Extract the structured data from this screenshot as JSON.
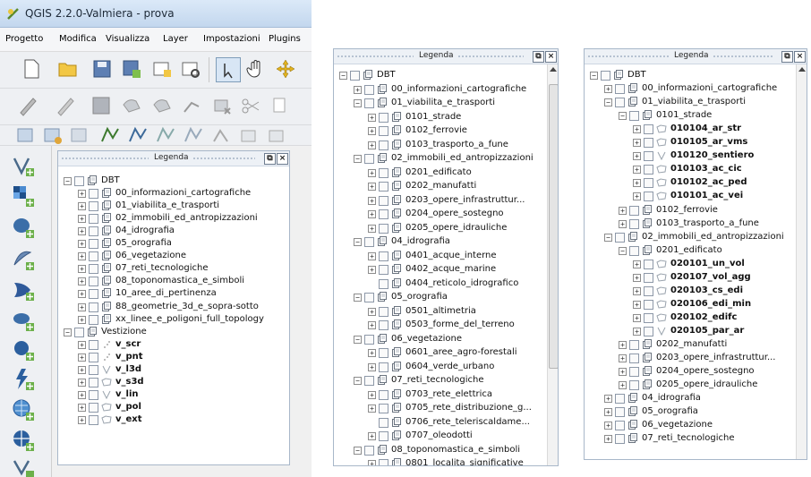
{
  "window": {
    "title": "QGIS 2.2.0-Valmiera - prova"
  },
  "menu": [
    "Progetto",
    "Modifica",
    "Visualizza",
    "Layer",
    "Impostazioni",
    "Plugins"
  ],
  "toolbar_row1": [
    "new-file-icon",
    "open-folder-icon",
    "save-icon",
    "save-as-icon",
    "new-print-composer-icon",
    "composer-manager-icon",
    "touch-select-icon",
    "pan-hand-icon",
    "pan-to-selection-icon"
  ],
  "toolbar_row2": [
    "digitize-pencil-icon",
    "toggle-editing-icon",
    "save-edits-icon",
    "add-feature-icon",
    "move-feature-icon",
    "node-tool-icon",
    "delete-selected-icon",
    "cut-features-icon",
    "copy-features-icon"
  ],
  "toolbar_row3": [
    "add-layer-icon",
    "remove-layer-icon",
    "layer-props-icon",
    "add-vector-icon",
    "add-raster-icon",
    "add-postgis-icon",
    "add-spatialite-icon",
    "add-wms-icon",
    "add-wfs-icon",
    "add-delimited-icon"
  ],
  "left_toolbar": [
    "add-vector-layer-icon",
    "add-raster-layer-icon",
    "add-postgis-layer-icon",
    "add-spatialite-layer-icon",
    "add-mssql-layer-icon",
    "add-oracle-layer-icon",
    "add-sqlanywhere-layer-icon",
    "add-wms-layer-icon",
    "add-wcs-layer-icon",
    "add-wfs-layer-icon",
    "add-delimited-text-icon"
  ],
  "legend_title": "Legenda",
  "panel1": {
    "rows": [
      {
        "label": "DBT",
        "level": 0,
        "exp": "-",
        "icon": "group",
        "bold": false
      },
      {
        "label": "00_informazioni_cartografiche",
        "level": 1,
        "exp": "+",
        "icon": "group",
        "bold": false
      },
      {
        "label": "01_viabilita_e_trasporti",
        "level": 1,
        "exp": "+",
        "icon": "group",
        "bold": false
      },
      {
        "label": "02_immobili_ed_antropizzazioni",
        "level": 1,
        "exp": "+",
        "icon": "group",
        "bold": false
      },
      {
        "label": "04_idrografia",
        "level": 1,
        "exp": "+",
        "icon": "group",
        "bold": false
      },
      {
        "label": "05_orografia",
        "level": 1,
        "exp": "+",
        "icon": "group",
        "bold": false
      },
      {
        "label": "06_vegetazione",
        "level": 1,
        "exp": "+",
        "icon": "group",
        "bold": false
      },
      {
        "label": "07_reti_tecnologiche",
        "level": 1,
        "exp": "+",
        "icon": "group",
        "bold": false
      },
      {
        "label": "08_toponomastica_e_simboli",
        "level": 1,
        "exp": "+",
        "icon": "group",
        "bold": false
      },
      {
        "label": "10_aree_di_pertinenza",
        "level": 1,
        "exp": "+",
        "icon": "group",
        "bold": false
      },
      {
        "label": "88_geometrie_3d_e_sopra-sotto",
        "level": 1,
        "exp": "+",
        "icon": "group",
        "bold": false
      },
      {
        "label": "xx_linee_e_poligoni_full_topology",
        "level": 1,
        "exp": "+",
        "icon": "group",
        "bold": false
      },
      {
        "label": "Vestizione",
        "level": 0,
        "exp": "-",
        "icon": "group",
        "bold": false
      },
      {
        "label": "v_scr",
        "level": 1,
        "exp": "+",
        "icon": "point",
        "bold": true
      },
      {
        "label": "v_pnt",
        "level": 1,
        "exp": "+",
        "icon": "point",
        "bold": true
      },
      {
        "label": "v_l3d",
        "level": 1,
        "exp": "+",
        "icon": "line",
        "bold": true
      },
      {
        "label": "v_s3d",
        "level": 1,
        "exp": "+",
        "icon": "poly",
        "bold": true
      },
      {
        "label": "v_lin",
        "level": 1,
        "exp": "+",
        "icon": "line",
        "bold": true
      },
      {
        "label": "v_pol",
        "level": 1,
        "exp": "+",
        "icon": "poly",
        "bold": true
      },
      {
        "label": "v_ext",
        "level": 1,
        "exp": "+",
        "icon": "poly",
        "bold": true
      }
    ]
  },
  "panel2": {
    "rows": [
      {
        "label": "DBT",
        "level": 0,
        "exp": "-",
        "icon": "group",
        "bold": false
      },
      {
        "label": "00_informazioni_cartografiche",
        "level": 1,
        "exp": "+",
        "icon": "group",
        "bold": false
      },
      {
        "label": "01_viabilita_e_trasporti",
        "level": 1,
        "exp": "-",
        "icon": "group",
        "bold": false
      },
      {
        "label": "0101_strade",
        "level": 2,
        "exp": "+",
        "icon": "group",
        "bold": false
      },
      {
        "label": "0102_ferrovie",
        "level": 2,
        "exp": "+",
        "icon": "group",
        "bold": false
      },
      {
        "label": "0103_trasporto_a_fune",
        "level": 2,
        "exp": "+",
        "icon": "group",
        "bold": false
      },
      {
        "label": "02_immobili_ed_antropizzazioni",
        "level": 1,
        "exp": "-",
        "icon": "group",
        "bold": false
      },
      {
        "label": "0201_edificato",
        "level": 2,
        "exp": "+",
        "icon": "group",
        "bold": false
      },
      {
        "label": "0202_manufatti",
        "level": 2,
        "exp": "+",
        "icon": "group",
        "bold": false
      },
      {
        "label": "0203_opere_infrastruttur...",
        "level": 2,
        "exp": "+",
        "icon": "group",
        "bold": false
      },
      {
        "label": "0204_opere_sostegno",
        "level": 2,
        "exp": "+",
        "icon": "group",
        "bold": false
      },
      {
        "label": "0205_opere_idrauliche",
        "level": 2,
        "exp": "+",
        "icon": "group",
        "bold": false
      },
      {
        "label": "04_idrografia",
        "level": 1,
        "exp": "-",
        "icon": "group",
        "bold": false
      },
      {
        "label": "0401_acque_interne",
        "level": 2,
        "exp": "+",
        "icon": "group",
        "bold": false
      },
      {
        "label": "0402_acque_marine",
        "level": 2,
        "exp": "+",
        "icon": "group",
        "bold": false
      },
      {
        "label": "0404_reticolo_idrografico",
        "level": 2,
        "exp": "",
        "icon": "group",
        "bold": false
      },
      {
        "label": "05_orografia",
        "level": 1,
        "exp": "-",
        "icon": "group",
        "bold": false
      },
      {
        "label": "0501_altimetria",
        "level": 2,
        "exp": "+",
        "icon": "group",
        "bold": false
      },
      {
        "label": "0503_forme_del_terreno",
        "level": 2,
        "exp": "+",
        "icon": "group",
        "bold": false
      },
      {
        "label": "06_vegetazione",
        "level": 1,
        "exp": "-",
        "icon": "group",
        "bold": false
      },
      {
        "label": "0601_aree_agro-forestali",
        "level": 2,
        "exp": "+",
        "icon": "group",
        "bold": false
      },
      {
        "label": "0604_verde_urbano",
        "level": 2,
        "exp": "+",
        "icon": "group",
        "bold": false
      },
      {
        "label": "07_reti_tecnologiche",
        "level": 1,
        "exp": "-",
        "icon": "group",
        "bold": false
      },
      {
        "label": "0703_rete_elettrica",
        "level": 2,
        "exp": "+",
        "icon": "group",
        "bold": false
      },
      {
        "label": "0705_rete_distribuzione_g...",
        "level": 2,
        "exp": "+",
        "icon": "group",
        "bold": false
      },
      {
        "label": "0706_rete_teleriscaldame...",
        "level": 2,
        "exp": "",
        "icon": "group",
        "bold": false
      },
      {
        "label": "0707_oleodotti",
        "level": 2,
        "exp": "+",
        "icon": "group",
        "bold": false
      },
      {
        "label": "08_toponomastica_e_simboli",
        "level": 1,
        "exp": "-",
        "icon": "group",
        "bold": false
      },
      {
        "label": "0801_localita_significative",
        "level": 2,
        "exp": "+",
        "icon": "group",
        "bold": false
      }
    ]
  },
  "panel3": {
    "rows": [
      {
        "label": "DBT",
        "level": 0,
        "exp": "-",
        "icon": "group",
        "bold": false
      },
      {
        "label": "00_informazioni_cartografiche",
        "level": 1,
        "exp": "+",
        "icon": "group",
        "bold": false
      },
      {
        "label": "01_viabilita_e_trasporti",
        "level": 1,
        "exp": "-",
        "icon": "group",
        "bold": false
      },
      {
        "label": "0101_strade",
        "level": 2,
        "exp": "-",
        "icon": "group",
        "bold": false
      },
      {
        "label": "010104_ar_str",
        "level": 3,
        "exp": "+",
        "icon": "poly",
        "bold": true
      },
      {
        "label": "010105_ar_vms",
        "level": 3,
        "exp": "+",
        "icon": "poly",
        "bold": true
      },
      {
        "label": "010120_sentiero",
        "level": 3,
        "exp": "+",
        "icon": "line",
        "bold": true
      },
      {
        "label": "010103_ac_cic",
        "level": 3,
        "exp": "+",
        "icon": "poly",
        "bold": true
      },
      {
        "label": "010102_ac_ped",
        "level": 3,
        "exp": "+",
        "icon": "poly",
        "bold": true
      },
      {
        "label": "010101_ac_vei",
        "level": 3,
        "exp": "+",
        "icon": "poly",
        "bold": true
      },
      {
        "label": "0102_ferrovie",
        "level": 2,
        "exp": "+",
        "icon": "group",
        "bold": false
      },
      {
        "label": "0103_trasporto_a_fune",
        "level": 2,
        "exp": "+",
        "icon": "group",
        "bold": false
      },
      {
        "label": "02_immobili_ed_antropizzazioni",
        "level": 1,
        "exp": "-",
        "icon": "group",
        "bold": false
      },
      {
        "label": "0201_edificato",
        "level": 2,
        "exp": "-",
        "icon": "group",
        "bold": false
      },
      {
        "label": "020101_un_vol",
        "level": 3,
        "exp": "+",
        "icon": "poly",
        "bold": true
      },
      {
        "label": "020107_vol_agg",
        "level": 3,
        "exp": "+",
        "icon": "poly",
        "bold": true
      },
      {
        "label": "020103_cs_edi",
        "level": 3,
        "exp": "+",
        "icon": "poly",
        "bold": true
      },
      {
        "label": "020106_edi_min",
        "level": 3,
        "exp": "+",
        "icon": "poly",
        "bold": true
      },
      {
        "label": "020102_edifc",
        "level": 3,
        "exp": "+",
        "icon": "poly",
        "bold": true
      },
      {
        "label": "020105_par_ar",
        "level": 3,
        "exp": "+",
        "icon": "line",
        "bold": true
      },
      {
        "label": "0202_manufatti",
        "level": 2,
        "exp": "+",
        "icon": "group",
        "bold": false
      },
      {
        "label": "0203_opere_infrastruttur...",
        "level": 2,
        "exp": "+",
        "icon": "group",
        "bold": false
      },
      {
        "label": "0204_opere_sostegno",
        "level": 2,
        "exp": "+",
        "icon": "group",
        "bold": false
      },
      {
        "label": "0205_opere_idrauliche",
        "level": 2,
        "exp": "+",
        "icon": "group",
        "bold": false
      },
      {
        "label": "04_idrografia",
        "level": 1,
        "exp": "+",
        "icon": "group",
        "bold": false
      },
      {
        "label": "05_orografia",
        "level": 1,
        "exp": "+",
        "icon": "group",
        "bold": false
      },
      {
        "label": "06_vegetazione",
        "level": 1,
        "exp": "+",
        "icon": "group",
        "bold": false
      },
      {
        "label": "07_reti_tecnologiche",
        "level": 1,
        "exp": "+",
        "icon": "group",
        "bold": false
      }
    ]
  }
}
